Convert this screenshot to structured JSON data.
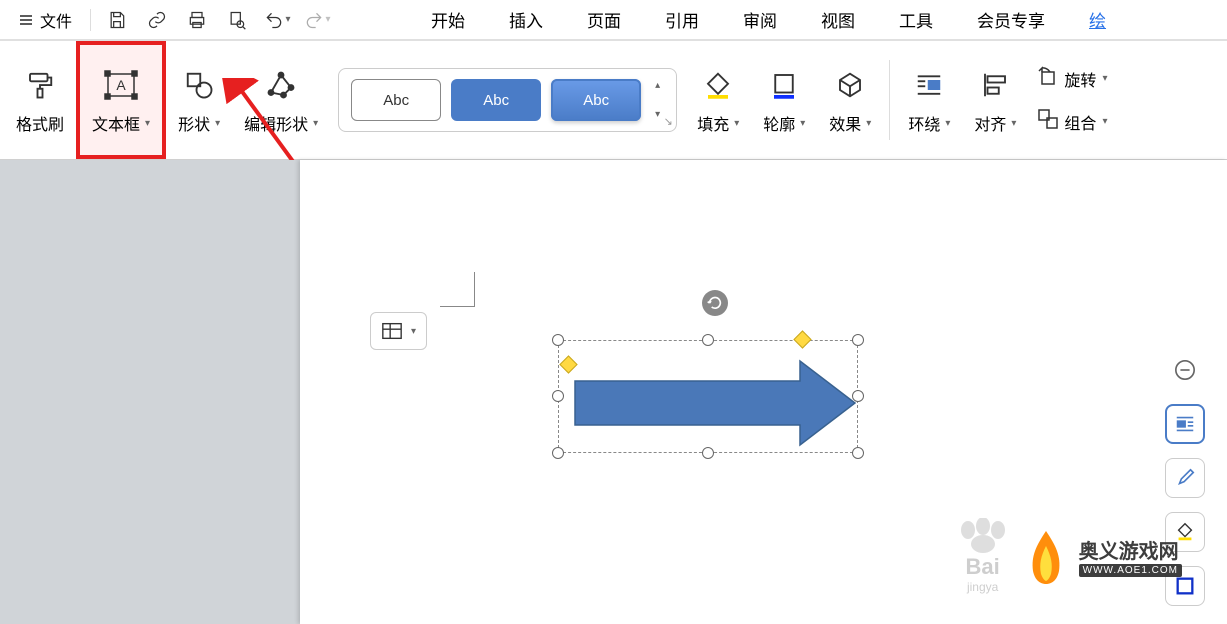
{
  "top": {
    "file_menu": "文件",
    "tabs": [
      "开始",
      "插入",
      "页面",
      "引用",
      "审阅",
      "视图",
      "工具",
      "会员专享"
    ],
    "active_cut": "绘"
  },
  "ribbon": {
    "format_painter": "格式刷",
    "text_box": "文本框",
    "shape": "形状",
    "edit_shape": "编辑形状",
    "style_label": "Abc",
    "fill": "填充",
    "outline": "轮廓",
    "effect": "效果",
    "wrap": "环绕",
    "align": "对齐",
    "rotate": "旋转",
    "group": "组合"
  },
  "watermark": {
    "baidu": "Bai",
    "baidu_sub": "jingya",
    "site_cn": "奥义游戏网",
    "site_en": "WWW.AOE1.COM"
  }
}
